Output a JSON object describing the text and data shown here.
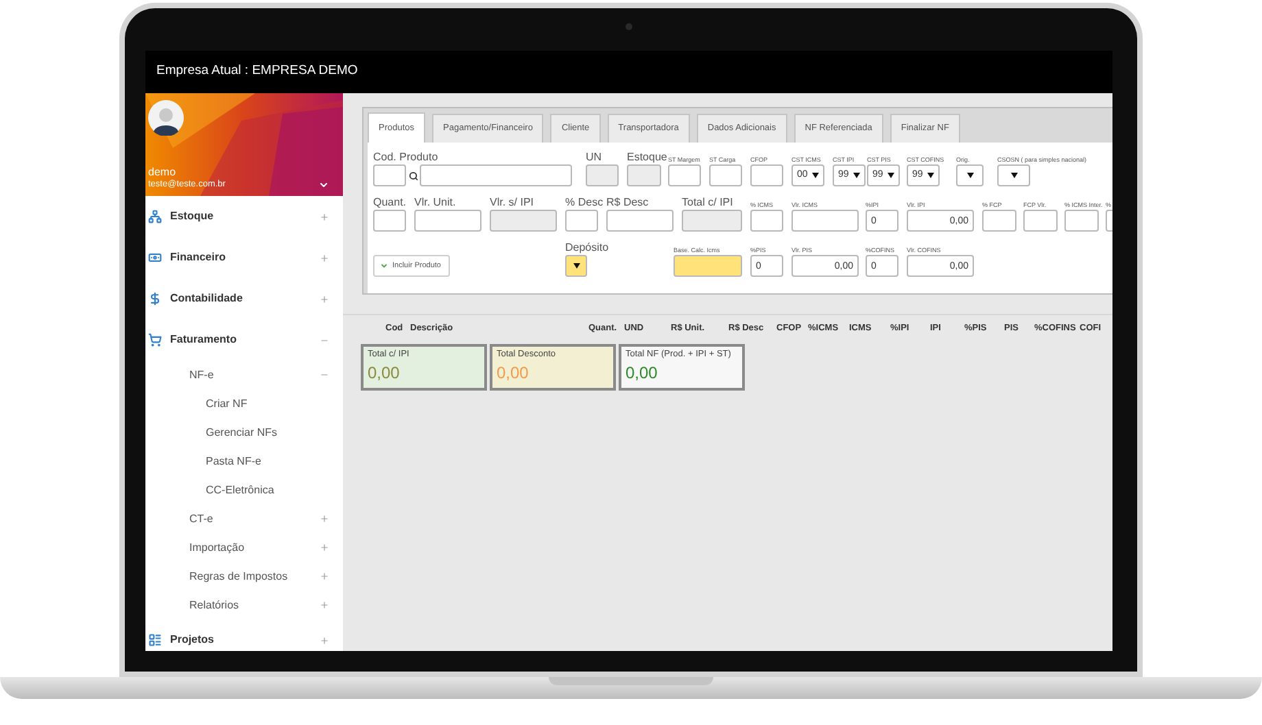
{
  "header": {
    "title": "Empresa Atual : EMPRESA DEMO"
  },
  "sidebar": {
    "user": {
      "name": "demo",
      "email": "teste@teste.com.br"
    },
    "items": [
      {
        "label": "Estoque",
        "expanded": false
      },
      {
        "label": "Financeiro",
        "expanded": false
      },
      {
        "label": "Contabilidade",
        "expanded": false
      },
      {
        "label": "Faturamento",
        "expanded": true,
        "children": [
          {
            "label": "NF-e",
            "expanded": true,
            "children": [
              {
                "label": "Criar NF"
              },
              {
                "label": "Gerenciar NFs"
              },
              {
                "label": "Pasta NF-e"
              },
              {
                "label": "CC-Eletrônica"
              }
            ]
          },
          {
            "label": "CT-e",
            "expanded": false
          },
          {
            "label": "Importação",
            "expanded": false
          },
          {
            "label": "Regras de Impostos",
            "expanded": false
          },
          {
            "label": "Relatórios",
            "expanded": false
          }
        ]
      },
      {
        "label": "Projetos",
        "expanded": false
      }
    ]
  },
  "tabs": [
    {
      "label": "Produtos",
      "selected": true
    },
    {
      "label": "Pagamento/Financeiro",
      "selected": false
    },
    {
      "label": "Cliente",
      "selected": false
    },
    {
      "label": "Transportadora",
      "selected": false
    },
    {
      "label": "Dados Adicionais",
      "selected": false
    },
    {
      "label": "NF Referenciada",
      "selected": false
    },
    {
      "label": "Finalizar NF",
      "selected": false
    }
  ],
  "form": {
    "fields": [
      {
        "label": "Cod. Produto",
        "kind": "lookup",
        "highlighted": false
      },
      {
        "label": "UN",
        "kind": "readonly",
        "highlighted": false
      },
      {
        "label": "Estoque",
        "kind": "readonly",
        "highlighted": false
      },
      {
        "label": "ST Margem",
        "kind": "text",
        "highlighted": false
      },
      {
        "label": "ST Carga",
        "kind": "text",
        "highlighted": false
      },
      {
        "label": "CFOP",
        "kind": "text",
        "highlighted": false
      },
      {
        "label": "CST ICMS",
        "kind": "select",
        "value": "00",
        "highlighted": false
      },
      {
        "label": "CST IPI",
        "kind": "select",
        "value": "99",
        "highlighted": false
      },
      {
        "label": "CST PIS",
        "kind": "select",
        "value": "99",
        "highlighted": false
      },
      {
        "label": "CST COFINS",
        "kind": "select",
        "value": "99",
        "highlighted": false
      },
      {
        "label": "Orig.",
        "kind": "select",
        "highlighted": false
      },
      {
        "label": "CSOSN ( para simples nacional)",
        "kind": "select",
        "highlighted": false
      },
      {
        "label": "Quant.",
        "kind": "text",
        "highlighted": false
      },
      {
        "label": "Vlr. Unit.",
        "kind": "text",
        "highlighted": false
      },
      {
        "label": "Vlr. s/ IPI",
        "kind": "readonly",
        "highlighted": false
      },
      {
        "label": "% Desc",
        "kind": "text",
        "highlighted": false
      },
      {
        "label": "R$ Desc",
        "kind": "text",
        "highlighted": false
      },
      {
        "label": "Total c/ IPI",
        "kind": "readonly",
        "highlighted": false
      },
      {
        "label": "% ICMS",
        "kind": "text",
        "highlighted": false
      },
      {
        "label": "Vlr. ICMS",
        "kind": "text",
        "highlighted": false
      },
      {
        "label": "%IPI",
        "kind": "text",
        "value": "0",
        "highlighted": false
      },
      {
        "label": "Vlr. IPI",
        "kind": "text",
        "value": "0,00",
        "highlighted": false
      },
      {
        "label": "% FCP",
        "kind": "text",
        "highlighted": false
      },
      {
        "label": "FCP Vlr.",
        "kind": "text",
        "highlighted": false
      },
      {
        "label": "% ICMS Inter.",
        "kind": "text",
        "highlighted": false
      },
      {
        "label": "%",
        "kind": "text",
        "highlighted": false
      },
      {
        "label": "Depósito",
        "kind": "select",
        "highlighted": true
      },
      {
        "label": "Base. Calc. Icms",
        "kind": "text",
        "highlighted": true
      },
      {
        "label": "%PIS",
        "kind": "text",
        "value": "0",
        "highlighted": false
      },
      {
        "label": "Vlr. PIS",
        "kind": "text",
        "value": "0,00",
        "highlighted": false
      },
      {
        "label": "%COFINS",
        "kind": "text",
        "value": "0",
        "highlighted": false
      },
      {
        "label": "Vlr. COFINS",
        "kind": "text",
        "value": "0,00",
        "highlighted": false
      }
    ],
    "action": {
      "label": "Incluir Produto"
    }
  },
  "table": {
    "columns": [
      "Cod",
      "Descrição",
      "Quant.",
      "UND",
      "R$ Unit.",
      "R$ Desc",
      "CFOP",
      "%ICMS",
      "ICMS",
      "%IPI",
      "IPI",
      "%PIS",
      "PIS",
      "%COFINS",
      "COFI"
    ]
  },
  "totals": [
    {
      "label": "Total c/ IPI",
      "value": "0,00",
      "color": "#8a8a3a"
    },
    {
      "label": "Total Desconto",
      "value": "0,00",
      "color": "#f39a4a"
    },
    {
      "label": "Total NF (Prod. + IPI + ST)",
      "value": "0,00",
      "color": "#2a8a2a"
    }
  ]
}
